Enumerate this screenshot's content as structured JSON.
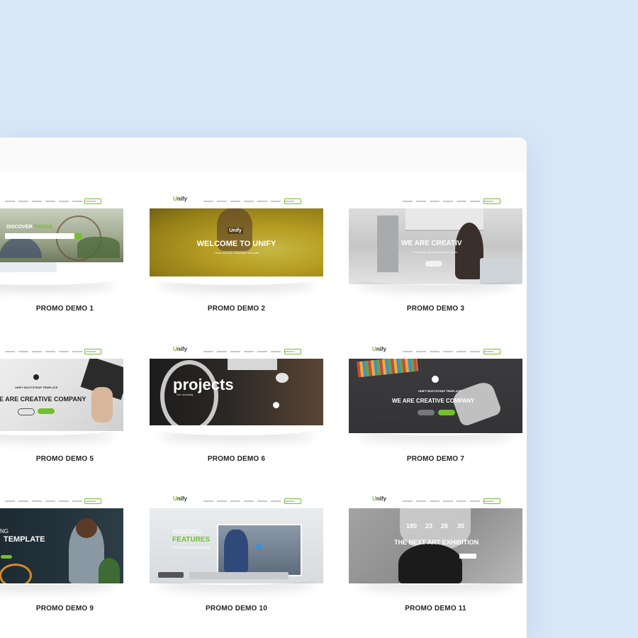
{
  "demos": [
    {
      "caption": "PROMO DEMO 1",
      "hero": "DISCOVER",
      "hero_accent": "THINGS",
      "colors": {
        "bg": "#8d9b7d",
        "accent": "#72c02c"
      }
    },
    {
      "caption": "PROMO DEMO 2",
      "logo": "Unify",
      "hero": "WELCOME TO UNIFY",
      "sub": "Clean and fully responsive template",
      "colors": {
        "bg": "#d8b52a"
      }
    },
    {
      "caption": "PROMO DEMO 3",
      "hero": "WE ARE CREATIV",
      "sub": "Clean and fully responsive template",
      "colors": {
        "bg": "#b8b9bb"
      }
    },
    {
      "caption": "PROMO DEMO 5",
      "kicker": "UNIFY BOOTSTRAP TEMPLATE",
      "hero": "E ARE CREATIVE COMPANY",
      "colors": {
        "bg": "#e9e9e9"
      }
    },
    {
      "caption": "PROMO DEMO 6",
      "hero": "projects",
      "sub": "Our branding",
      "colors": {
        "bg": "#2e2b28"
      }
    },
    {
      "caption": "PROMO DEMO 7",
      "kicker": "UNIFY BOOTSTRAP TEMPLATE",
      "hero": "WE ARE CREATIVE COMPANY",
      "colors": {
        "bg": "#3a3a3c"
      }
    },
    {
      "caption": "PROMO DEMO 9",
      "hero_top": "NG",
      "hero": "TEMPLATE",
      "colors": {
        "bg": "#1f2b33"
      }
    },
    {
      "caption": "PROMO DEMO 10",
      "hero_top": "AMAZING",
      "hero": "FEATURES",
      "sub": "Unify bootstrap template",
      "colors": {
        "bg": "#dfe3e6",
        "accent": "#72c02c"
      }
    },
    {
      "caption": "PROMO DEMO 11",
      "counts": [
        "180",
        "23",
        "26",
        "35"
      ],
      "hero": "THE NEXT ART EXHIBITION",
      "colors": {
        "bg": "#8a8a8a"
      }
    }
  ]
}
